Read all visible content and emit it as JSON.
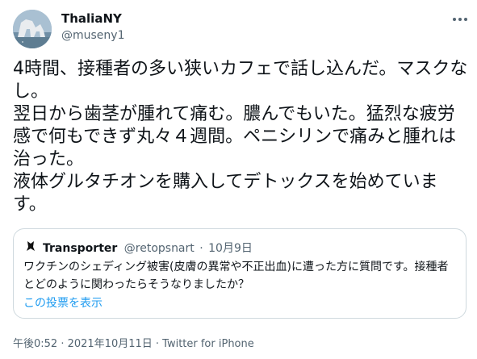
{
  "author": {
    "display_name": "ThaliaNY",
    "handle": "@museny1",
    "avatar_icon": "avatar-image"
  },
  "more_icon": "more-horizontal-icon",
  "tweet": {
    "lines": [
      "4時間、接種者の多い狭いカフェで話し込んだ。マスクなし。",
      "翌日から歯茎が腫れて痛む。膿んでもいた。猛烈な疲労感で何もできず丸々４週間。ペニシリンで痛みと腫れは治った。",
      "液体グルタチオンを購入してデトックスを始めています。"
    ]
  },
  "quote": {
    "name": "Transporter",
    "handle": "@retopsnart",
    "separator": "·",
    "date": "10月9日",
    "text": "ワクチンのシェディング被害(皮膚の異常や不正出血)に遭った方に質問です。接種者とどのように関わったらそうなりましたか？",
    "poll_link": "この投票を表示"
  },
  "footer": {
    "timestamp": "午後0:52 · 2021年10月11日 · Twitter for iPhone"
  },
  "colors": {
    "text": "#0f1419",
    "secondary": "#536471",
    "link": "#1d9bf0",
    "border": "#cfd9de"
  }
}
